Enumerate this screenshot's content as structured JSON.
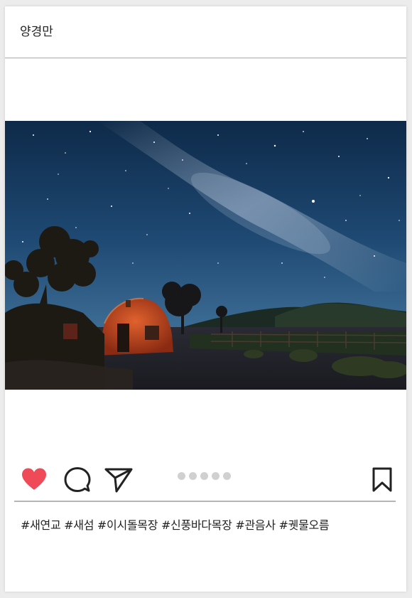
{
  "post": {
    "username": "양경만",
    "image_alt": "Milky Way night sky over a lit arched barn and trees",
    "carousel": {
      "total": 5,
      "active_index": 0
    },
    "actions": {
      "like_icon": "heart-filled-icon",
      "comment_icon": "speech-bubble-icon",
      "share_icon": "paper-plane-icon",
      "save_icon": "bookmark-icon",
      "liked": true
    },
    "hashtags": [
      "#새연교",
      "#새섬",
      "#이시돌목장",
      "#신풍바다목장",
      "#관음사",
      "#궷물오름"
    ]
  },
  "colors": {
    "like": "#ee4a57",
    "icon_stroke": "#222222",
    "divider": "#b5b5b5",
    "dot": "#d0d0d0"
  }
}
